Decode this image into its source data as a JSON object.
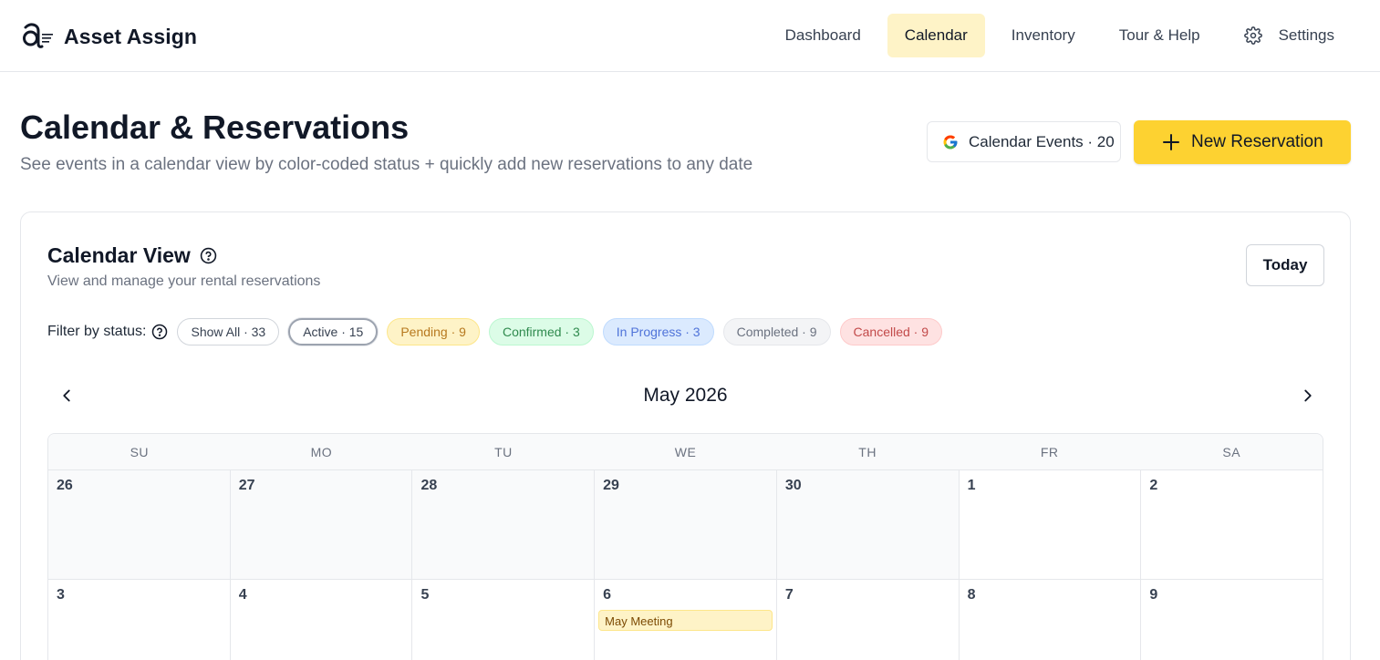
{
  "brand": {
    "name": "Asset Assign",
    "logo_icon": "asset-assign-logo"
  },
  "nav": {
    "items": [
      {
        "label": "Dashboard",
        "active": false
      },
      {
        "label": "Calendar",
        "active": true
      },
      {
        "label": "Inventory",
        "active": false
      },
      {
        "label": "Tour & Help",
        "active": false
      },
      {
        "label": "Settings",
        "active": false,
        "icon": "gear-icon"
      }
    ]
  },
  "page": {
    "title": "Calendar & Reservations",
    "subtitle": "See events in a calendar view by color-coded status + quickly add new reservations to any date",
    "gcal_button": "Calendar Events · 20",
    "new_button": "New Reservation"
  },
  "card": {
    "title": "Calendar View",
    "subtitle": "View and manage your rental reservations",
    "today_button": "Today",
    "filter_label": "Filter by status:",
    "filters": [
      {
        "label": "Show All · 33",
        "kind": "all"
      },
      {
        "label": "Active · 15",
        "kind": "active"
      },
      {
        "label": "Pending · 9",
        "kind": "pending"
      },
      {
        "label": "Confirmed · 3",
        "kind": "confirmed"
      },
      {
        "label": "In Progress · 3",
        "kind": "progress"
      },
      {
        "label": "Completed · 9",
        "kind": "completed"
      },
      {
        "label": "Cancelled · 9",
        "kind": "cancelled"
      }
    ]
  },
  "calendar": {
    "month_label": "May 2026",
    "weekdays": [
      "SU",
      "MO",
      "TU",
      "WE",
      "TH",
      "FR",
      "SA"
    ],
    "weeks": [
      [
        {
          "day": "26",
          "out": true
        },
        {
          "day": "27",
          "out": true
        },
        {
          "day": "28",
          "out": true
        },
        {
          "day": "29",
          "out": true
        },
        {
          "day": "30",
          "out": true
        },
        {
          "day": "1",
          "out": false
        },
        {
          "day": "2",
          "out": false
        }
      ],
      [
        {
          "day": "3",
          "out": false
        },
        {
          "day": "4",
          "out": false
        },
        {
          "day": "5",
          "out": false
        },
        {
          "day": "6",
          "out": false,
          "event": "May Meeting"
        },
        {
          "day": "7",
          "out": false
        },
        {
          "day": "8",
          "out": false
        },
        {
          "day": "9",
          "out": false
        }
      ]
    ]
  },
  "colors": {
    "accent": "#fdd231",
    "nav_active_bg": "#fef3c7",
    "pending": "#fef3c7",
    "confirmed": "#dcfce7",
    "in_progress": "#dbeafe",
    "completed": "#f3f4f6",
    "cancelled": "#fee2e2"
  }
}
